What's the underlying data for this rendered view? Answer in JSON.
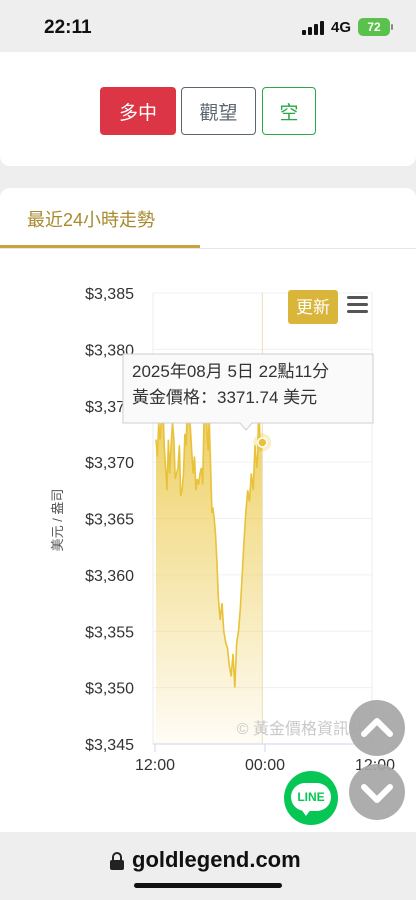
{
  "status_bar": {
    "time": "22:11",
    "network": "4G",
    "battery": "72"
  },
  "vote_buttons": {
    "long_label": "多中",
    "watch_label": "觀望",
    "short_label": "空"
  },
  "tab": {
    "label": "最近24小時走勢"
  },
  "chart": {
    "refresh_label": "更新",
    "watermark": "© 黃金價格資訊站",
    "tooltip": {
      "line1": "2025年08月 5日 22點11分",
      "line2": "黃金價格：3371.74 美元"
    },
    "colors": {
      "line": "#e8c23a",
      "fill_top": "#ecc94b",
      "accent": "#d9b53a"
    }
  },
  "chart_data": {
    "type": "area",
    "title": "",
    "xlabel": "",
    "ylabel": "美元 / 盎司",
    "ylim": [
      3345,
      3385
    ],
    "yticks": [
      "$3,345",
      "$3,350",
      "$3,355",
      "$3,360",
      "$3,365",
      "$3,370",
      "$3,375",
      "$3,380",
      "$3,385"
    ],
    "xticks": [
      "12:00",
      "00:00",
      "12:00"
    ],
    "x_hours": [
      0,
      0.3,
      0.6,
      0.9,
      1.2,
      1.5,
      1.8,
      2.1,
      2.4,
      2.7,
      3.0,
      3.3,
      3.6,
      3.9,
      4.2,
      4.5,
      4.8,
      5.1,
      5.4,
      5.7,
      6.0,
      6.3,
      6.6,
      6.9,
      7.2,
      7.5,
      7.8,
      8.1,
      8.4,
      8.7,
      9.0,
      9.3,
      9.6,
      9.9,
      10.2,
      10.5,
      10.8,
      11.0,
      11.2,
      11.4,
      11.6,
      11.8,
      12.0,
      12.2,
      12.4,
      12.7,
      13.0,
      13.3,
      13.6,
      14.0,
      14.4,
      14.8,
      15.2,
      15.6,
      16.0,
      16.4,
      16.8,
      17.2,
      17.6,
      18.0,
      18.4,
      18.8,
      19.2,
      19.6,
      20.0,
      20.4,
      20.8,
      21.2,
      21.6,
      22.0,
      22.2,
      22.4,
      22.8,
      23.2
    ],
    "values": [
      3372.0,
      3370.5,
      3373.5,
      3372.0,
      3374.0,
      3375.5,
      3371.5,
      3369.5,
      3367.5,
      3372.0,
      3369.0,
      3371.5,
      3373.5,
      3372.0,
      3368.5,
      3369.0,
      3369.5,
      3371.5,
      3367.0,
      3367.5,
      3369.0,
      3372.5,
      3371.5,
      3376.0,
      3375.0,
      3373.0,
      3371.0,
      3369.0,
      3370.5,
      3367.5,
      3368.5,
      3368.0,
      3369.0,
      3369.5,
      3368.0,
      3374.0,
      3377.5,
      3375.0,
      3372.0,
      3371.0,
      3374.0,
      3371.0,
      3368.5,
      3365.5,
      3366.0,
      3365.0,
      3363.5,
      3361.0,
      3358.0,
      3356.0,
      3357.5,
      3355.0,
      3354.0,
      3353.5,
      3352.0,
      3351.0,
      3353.0,
      3350.0,
      3354.0,
      3355.0,
      3357.0,
      3360.0,
      3363.0,
      3365.5,
      3367.5,
      3366.5,
      3369.0,
      3367.5,
      3371.5,
      3369.5,
      3370.5,
      3375.0,
      3371.0,
      3371.74
    ],
    "highlight": {
      "x_hours": 23.2,
      "value": 3371.74
    }
  }
}
